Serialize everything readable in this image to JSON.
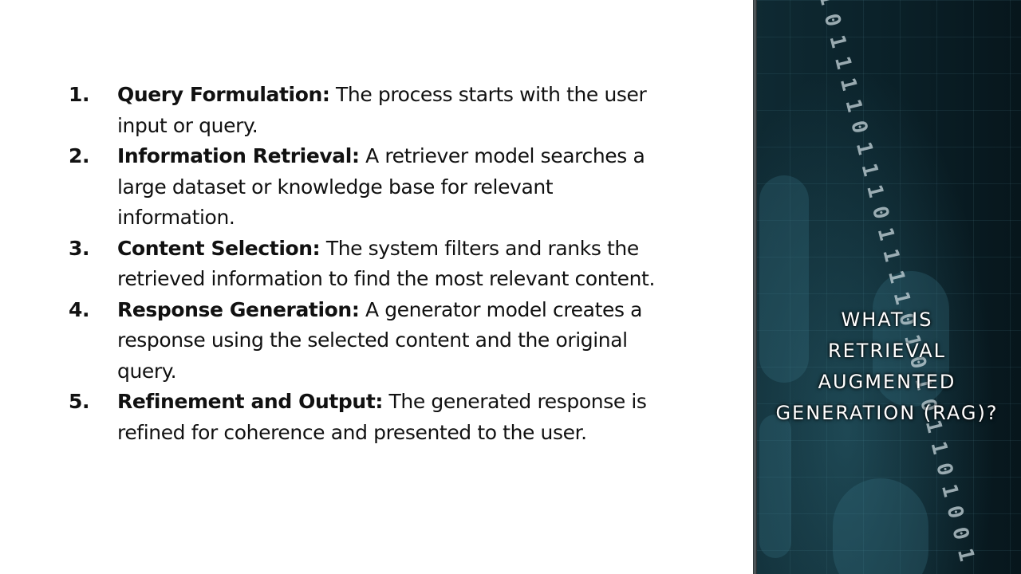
{
  "steps": [
    {
      "number": "1.",
      "term": "Query Formulation:",
      "text": " The process starts with the user input or query."
    },
    {
      "number": "2.",
      "term": "Information Retrieval:",
      "text": " A retriever model searches a large dataset or knowledge base for relevant information."
    },
    {
      "number": "3.",
      "term": "Content Selection:",
      "text": " The system filters and ranks the retrieved information to find the most relevant content."
    },
    {
      "number": "4.",
      "term": "Response Generation:",
      "text": " A generator model creates a response using the selected content and the original query."
    },
    {
      "number": "5.",
      "term": "Refinement and Output:",
      "text": " The generated response is refined for coherence and presented to the user."
    }
  ],
  "sidebar": {
    "binary_text": "101111011101111010101101001",
    "title_lines": [
      "WHAT IS",
      "RETRIEVAL",
      "AUGMENTED",
      "GENERATION (RAG)?"
    ]
  },
  "colors": {
    "background": "#ffffff",
    "text": "#111111",
    "panel_dark": "#07161c",
    "panel_accent": "#3a788a",
    "title": "#ffffff"
  }
}
